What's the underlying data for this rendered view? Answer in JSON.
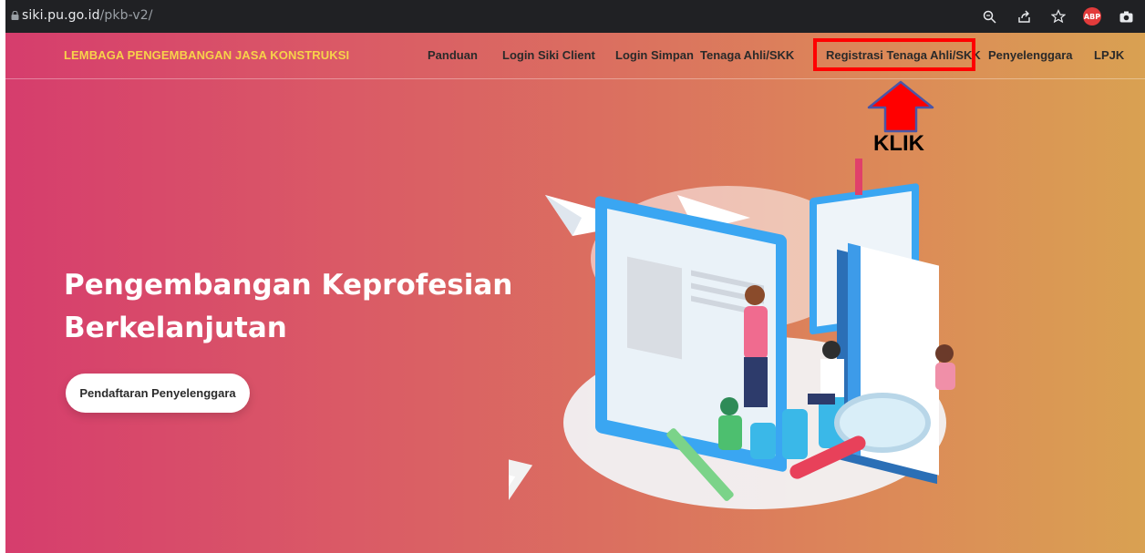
{
  "browser": {
    "url_host": "siki.pu.go.id",
    "url_path": "/pkb-v2/",
    "extension_badge": "ABP"
  },
  "nav": {
    "brand": "LEMBAGA PENGEMBANGAN JASA KONSTRUKSI",
    "items": [
      {
        "label": "Panduan"
      },
      {
        "label": "Login Siki Client"
      },
      {
        "label": "Login Simpan"
      },
      {
        "label": "Tenaga Ahli/SKK"
      },
      {
        "label": "Registrasi Tenaga Ahli/SKK"
      },
      {
        "label": "Penyelenggara"
      },
      {
        "label": "LPJK"
      }
    ]
  },
  "annotation": {
    "label": "KLIK",
    "box_color": "#ff0000",
    "arrow_color": "#ff0000"
  },
  "hero": {
    "title_line1": "Pengembangan Keprofesian",
    "title_line2": "Berkelanjutan",
    "cta_label": "Pendaftaran Penyelenggara"
  },
  "colors": {
    "gradient_start": "#d63d6d",
    "gradient_end": "#d9a152",
    "brand": "#f7d34a"
  }
}
